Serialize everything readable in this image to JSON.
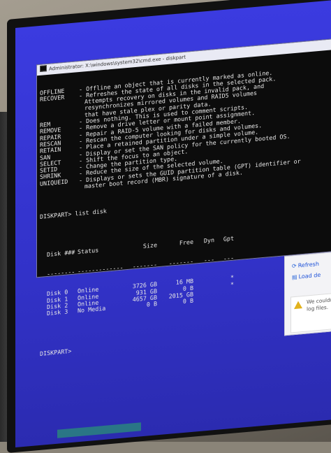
{
  "window": {
    "title": "Administrator: X:\\windows\\system32\\cmd.exe - diskpart"
  },
  "commands": [
    {
      "name": "OFFLINE",
      "desc": "- Offline an object that is currently marked as online."
    },
    {
      "name": "RECOVER",
      "desc": "- Refreshes the state of all disks in the selected pack."
    },
    {
      "name": "",
      "desc": "Attempts recovery on disks in the invalid pack, and"
    },
    {
      "name": "",
      "desc": "resynchronizes mirrored volumes and RAID5 volumes"
    },
    {
      "name": "",
      "desc": "that have stale plex or parity data."
    },
    {
      "name": "REM",
      "desc": "- Does nothing. This is used to comment scripts."
    },
    {
      "name": "REMOVE",
      "desc": "- Remove a drive letter or mount point assignment."
    },
    {
      "name": "REPAIR",
      "desc": "- Repair a RAID-5 volume with a failed member."
    },
    {
      "name": "RESCAN",
      "desc": "- Rescan the computer looking for disks and volumes."
    },
    {
      "name": "RETAIN",
      "desc": "- Place a retained partition under a simple volume."
    },
    {
      "name": "SAN",
      "desc": "- Display or set the SAN policy for the currently booted OS."
    },
    {
      "name": "SELECT",
      "desc": "- Shift the focus to an object."
    },
    {
      "name": "SETID",
      "desc": "- Change the partition type."
    },
    {
      "name": "SHRINK",
      "desc": "- Reduce the size of the selected volume."
    },
    {
      "name": "UNIQUEID",
      "desc": "- Displays or sets the GUID partition table (GPT) identifier or"
    },
    {
      "name": "",
      "desc": "master boot record (MBR) signature of a disk."
    }
  ],
  "prompt_command": "DISKPART> list disk",
  "disk_table": {
    "headers": [
      "Disk ###",
      "Status",
      "Size",
      "Free",
      "Dyn",
      "Gpt"
    ],
    "separators": [
      "--------",
      "-------------",
      "-------",
      "-------",
      "---",
      "---"
    ],
    "rows": [
      [
        "Disk 0",
        "Online",
        "3726 GB",
        "16 MB",
        "",
        "*"
      ],
      [
        "Disk 1",
        "Online",
        "931 GB",
        "0 B",
        "",
        "*"
      ],
      [
        "Disk 2",
        "Online",
        "4657 GB",
        "2015 GB",
        "",
        ""
      ],
      [
        "Disk 3",
        "No Media",
        "0 B",
        "0 B",
        "",
        ""
      ]
    ]
  },
  "prompt_final": "DISKPART>",
  "side_panel": {
    "refresh_label": "Refresh",
    "load_label": "Load de",
    "warning_text_1": "We couldn'",
    "warning_text_2": "log files."
  }
}
